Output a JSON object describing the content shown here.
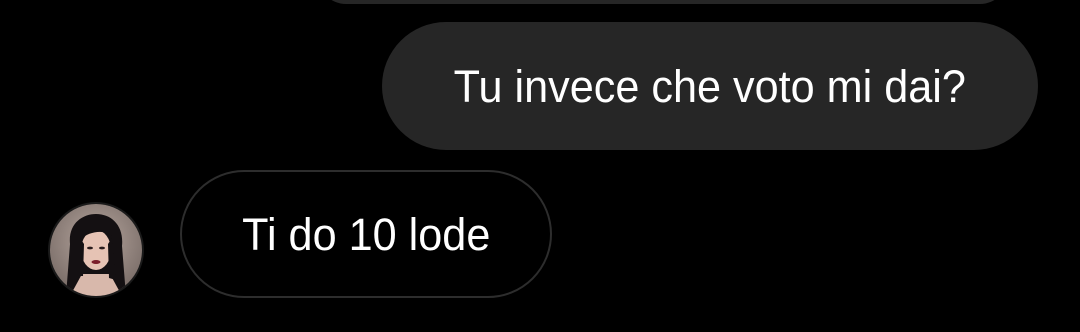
{
  "chat": {
    "messages": [
      {
        "sender": "me",
        "text": "Tu invece che voto mi dai?"
      },
      {
        "sender": "contact",
        "text": "Ti do 10 lode"
      }
    ],
    "contact": {
      "avatar_icon": "profile-photo"
    }
  },
  "colors": {
    "background": "#000000",
    "outgoing_bubble": "#262626",
    "incoming_bubble_border": "#2d2d2d",
    "text": "#ffffff"
  }
}
